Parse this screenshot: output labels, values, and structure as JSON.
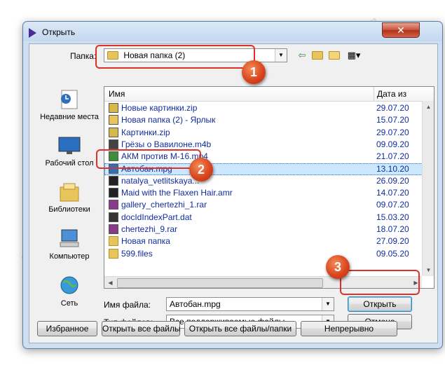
{
  "window": {
    "title": "Открыть",
    "close_glyph": "✕"
  },
  "look_in": {
    "label": "Папка:",
    "value": "Новая папка (2)"
  },
  "places": [
    {
      "label": "Недавние места"
    },
    {
      "label": "Рабочий стол"
    },
    {
      "label": "Библиотеки"
    },
    {
      "label": "Компьютер"
    },
    {
      "label": "Сеть"
    }
  ],
  "file_list": {
    "columns": {
      "name": "Имя",
      "date": "Дата из"
    },
    "rows": [
      {
        "name": "Новые картинки.zip",
        "date": "29.07.20",
        "icon": "zip"
      },
      {
        "name": "Новая папка (2) - Ярлык",
        "date": "15.07.20",
        "icon": "shortcut"
      },
      {
        "name": "Картинки.zip",
        "date": "29.07.20",
        "icon": "zip"
      },
      {
        "name": "Грёзы о Вавилоне.m4b",
        "date": "09.09.20",
        "icon": "m4b"
      },
      {
        "name": "АКМ против М-16.mp4",
        "date": "21.07.20",
        "icon": "mp4"
      },
      {
        "name": "Автобан.mpg",
        "date": "13.10.20",
        "icon": "mpg",
        "selected": true
      },
      {
        "name": "natalya_vetlitskaya...",
        "date": "26.09.20",
        "icon": "flac"
      },
      {
        "name": "Maid with the Flaxen Hair.amr",
        "date": "14.07.20",
        "icon": "amr"
      },
      {
        "name": "gallery_chertezhi_1.rar",
        "date": "09.07.20",
        "icon": "rar"
      },
      {
        "name": "docIdIndexPart.dat",
        "date": "15.03.20",
        "icon": "dat"
      },
      {
        "name": "chertezhi_9.rar",
        "date": "18.07.20",
        "icon": "rar"
      },
      {
        "name": "Новая папка",
        "date": "27.09.20",
        "icon": "folder"
      },
      {
        "name": "599.files",
        "date": "09.05.20",
        "icon": "folder"
      }
    ]
  },
  "filename": {
    "label": "Имя файла:",
    "value": "Автобан.mpg"
  },
  "filetype": {
    "label": "Тип файлов:",
    "value": "Все поддерживаемые файлы"
  },
  "buttons": {
    "open": "Открыть",
    "cancel": "Отмена",
    "favorites": "Избранное",
    "open_all": "Открыть все файлы",
    "open_all_folders": "Открыть все файлы/папки",
    "continuous": "Непрерывно"
  },
  "callouts": [
    "1",
    "2",
    "3"
  ],
  "watermark_text": "Soringpcrepair.com",
  "colors": {
    "link": "#0f2d9d",
    "accent": "#e0302a",
    "selection": "#cce8ff"
  }
}
